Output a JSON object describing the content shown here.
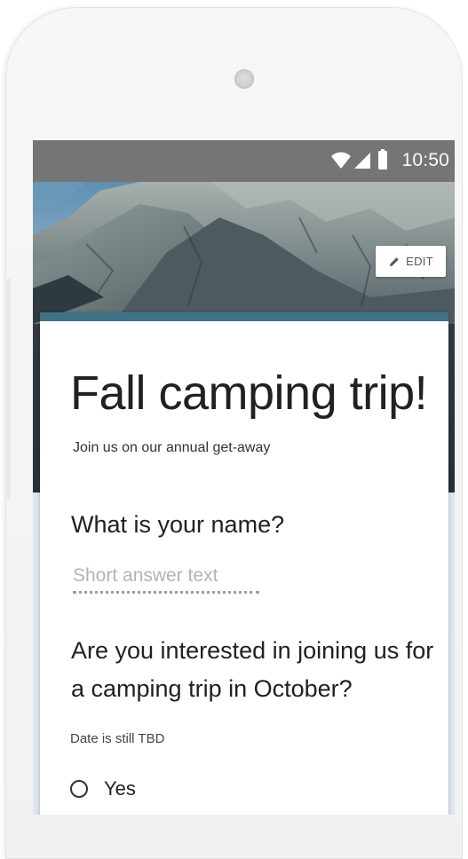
{
  "status_bar": {
    "time": "10:50",
    "icons": [
      "wifi-icon",
      "cell-signal-icon",
      "battery-icon"
    ]
  },
  "header": {
    "edit_label": "EDIT",
    "edit_icon": "pencil-icon"
  },
  "form": {
    "title": "Fall camping trip!",
    "description": "Join us on our annual get-away",
    "questions": [
      {
        "text": "What is your name?",
        "placeholder": "Short answer text"
      },
      {
        "text": "Are you interested in joining us for a camping trip in October?",
        "help": "Date is still TBD",
        "options": [
          "Yes"
        ]
      }
    ]
  },
  "colors": {
    "status_bar": "#757575",
    "accent": "#3f7285",
    "background": "#dfe5ea"
  }
}
